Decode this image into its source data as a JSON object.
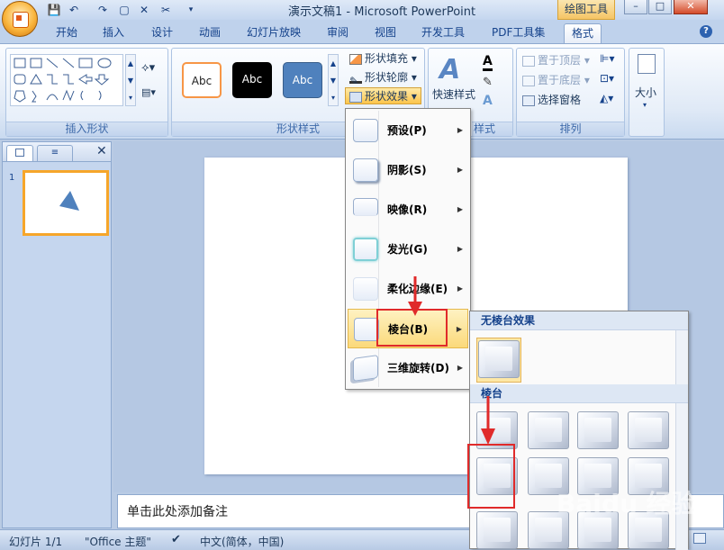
{
  "window": {
    "title": "演示文稿1 - Microsoft PowerPoint",
    "contextual_badge": "绘图工具"
  },
  "tabs": [
    "开始",
    "插入",
    "设计",
    "动画",
    "幻灯片放映",
    "审阅",
    "视图",
    "开发工具",
    "PDF工具集",
    "格式"
  ],
  "ribbon": {
    "insert_shapes_label": "插入形状",
    "shape_styles_label": "形状样式",
    "style_preset_text": "Abc",
    "shape_fill": "形状填充",
    "shape_outline": "形状轮廓",
    "shape_effects": "形状效果",
    "quick_styles": "快速样式",
    "art_styles_tail": "样式",
    "bring_front": "置于顶层",
    "send_back": "置于底层",
    "selection_pane": "选择窗格",
    "arrange_label": "排列",
    "size_label": "大小"
  },
  "effects_menu": {
    "items": [
      {
        "label": "预设(P)"
      },
      {
        "label": "阴影(S)"
      },
      {
        "label": "映像(R)"
      },
      {
        "label": "发光(G)"
      },
      {
        "label": "柔化边缘(E)"
      },
      {
        "label": "棱台(B)"
      },
      {
        "label": "三维旋转(D)"
      }
    ],
    "highlighted": "棱台(B)"
  },
  "bevel_submenu": {
    "no_bevel_heading": "无棱台效果",
    "bevel_heading": "棱台"
  },
  "notes_placeholder": "单击此处添加备注",
  "slide_number": "1",
  "status": {
    "slide_info": "幻灯片 1/1",
    "theme": "\"Office 主题\"",
    "language": "中文(简体，中国)"
  },
  "watermark": "Baidu 经验",
  "colors": {
    "accent_orange": "#f6a62a",
    "highlight_red": "#e02a2a",
    "triangle_blue": "#4f81bd"
  }
}
